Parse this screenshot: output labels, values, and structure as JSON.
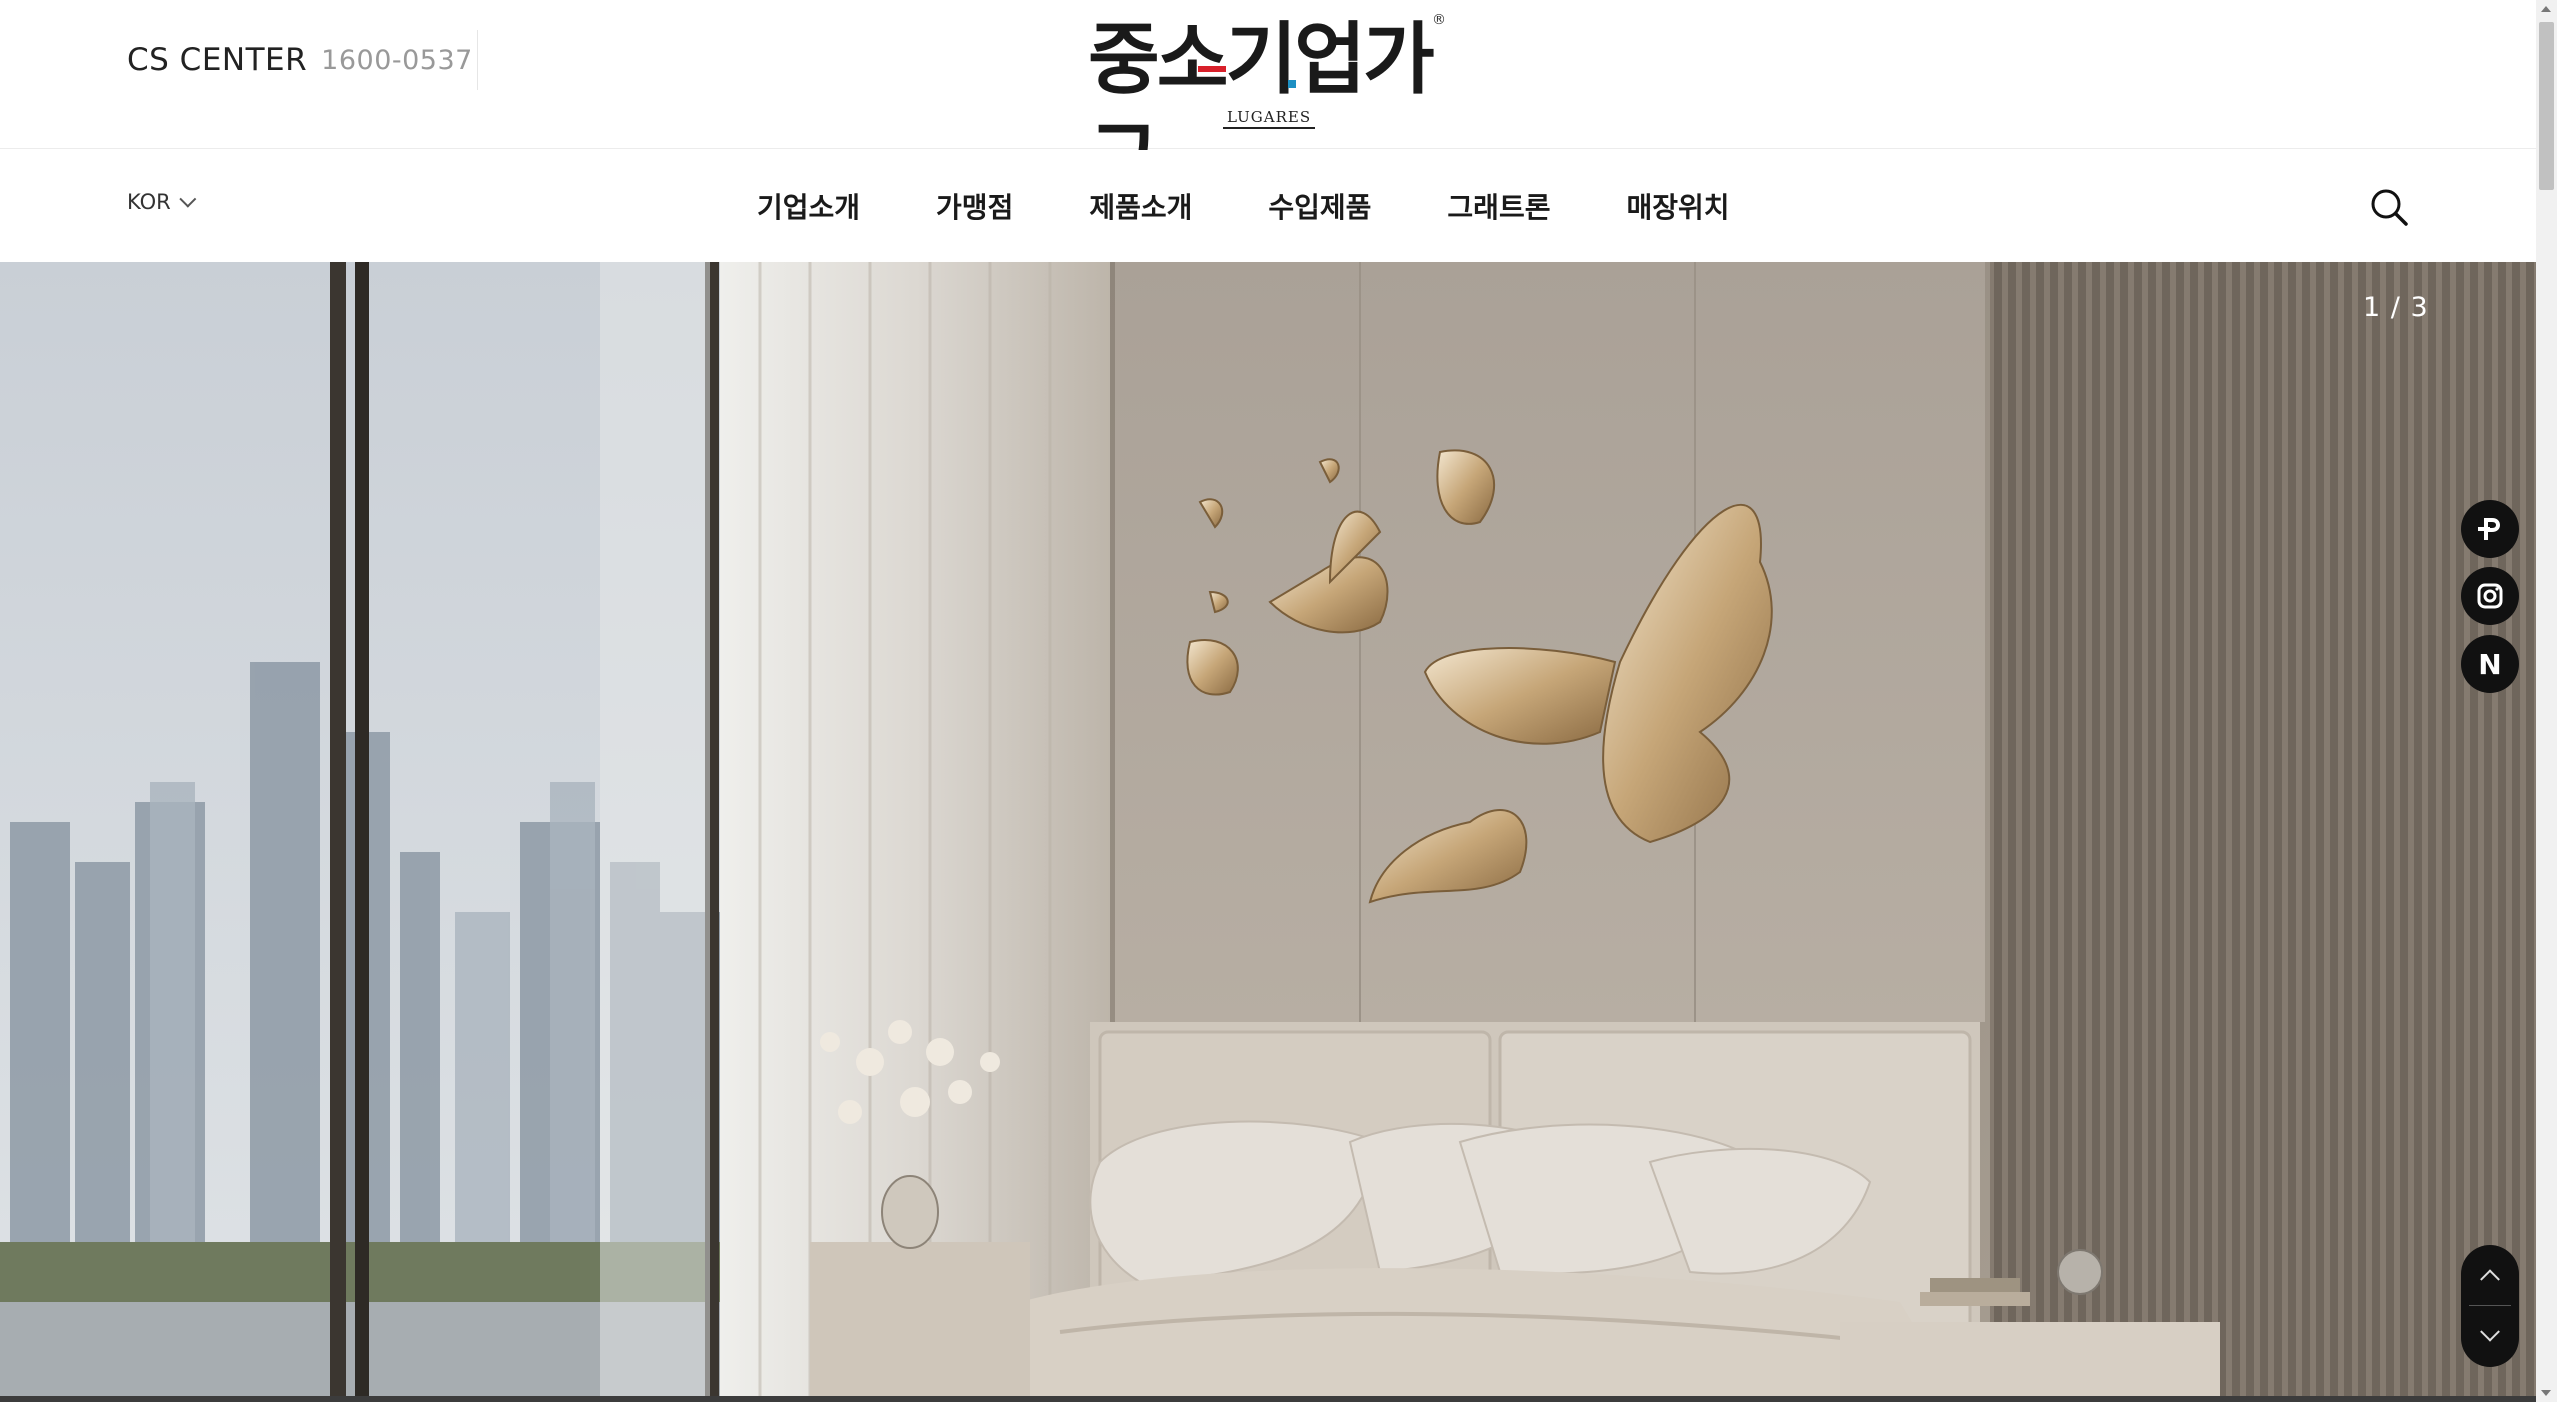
{
  "header": {
    "cs_label": "CS CENTER",
    "cs_phone": "1600-0537",
    "logo_text": "중소기업가구",
    "logo_sub": "LUGARES",
    "logo_reg": "®"
  },
  "nav": {
    "language": "KOR",
    "menu": [
      {
        "label": "기업소개"
      },
      {
        "label": "가맹점"
      },
      {
        "label": "제품소개"
      },
      {
        "label": "수입제품"
      },
      {
        "label": "그래트론"
      },
      {
        "label": "매장위치"
      }
    ]
  },
  "hero": {
    "slide_counter": "1 / 3",
    "social": [
      {
        "icon": "p-logo-icon"
      },
      {
        "icon": "instagram-icon"
      },
      {
        "icon": "naver-blog-icon",
        "letter": "N"
      }
    ]
  },
  "colors": {
    "accent_red": "#d8202a",
    "accent_blue": "#1d8fc2",
    "button_dark": "#111111"
  }
}
